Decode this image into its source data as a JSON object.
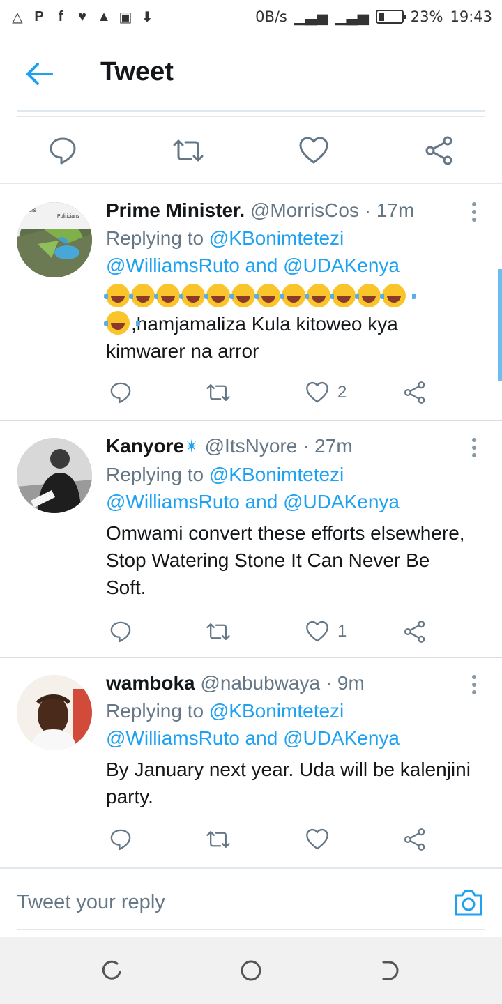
{
  "status_bar": {
    "icons_left": [
      "warning-icon",
      "parking-icon",
      "facebook-icon",
      "twitter-icon",
      "lock-icon",
      "image-icon",
      "download-icon"
    ],
    "net_speed": "0B/s",
    "battery_percent": "23%",
    "battery_level": 0.23,
    "time": "19:43"
  },
  "header": {
    "title": "Tweet"
  },
  "colors": {
    "accent": "#1da1f2",
    "icon_gray": "#657786"
  },
  "tweets": [
    {
      "name": "Prime Minister.",
      "handle": "@MorrisCos · 17m",
      "replying_prefix": "Replying to ",
      "replying_1": "@KBonimtetezi",
      "replying_2": "@WilliamsRuto",
      "replying_and": " and ",
      "replying_3": "@UDAKenya",
      "emoji_count": 12,
      "text": ",hamjamaliza Kula kitoweo kya kimwarer na arror",
      "likes": "2"
    },
    {
      "name": "Kanyore",
      "handle": "@ItsNyore · 27m",
      "replying_prefix": "Replying to ",
      "replying_1": "@KBonimtetezi",
      "replying_2": "@WilliamsRuto",
      "replying_and": " and ",
      "replying_3": "@UDAKenya",
      "text": "Omwami convert these efforts elsewhere, Stop Watering Stone It Can Never Be Soft.",
      "likes": "1"
    },
    {
      "name": "wamboka",
      "handle": "@nabubwaya · 9m",
      "replying_prefix": "Replying to ",
      "replying_1": "@KBonimtetezi",
      "replying_2": "@WilliamsRuto",
      "replying_and": " and ",
      "replying_3": "@UDAKenya",
      "text": "By January next year. Uda will be kalenjini party.",
      "likes": ""
    }
  ],
  "avatar_1_labels": [
    "aters",
    "Politicians"
  ],
  "composer": {
    "placeholder": "Tweet your reply"
  }
}
